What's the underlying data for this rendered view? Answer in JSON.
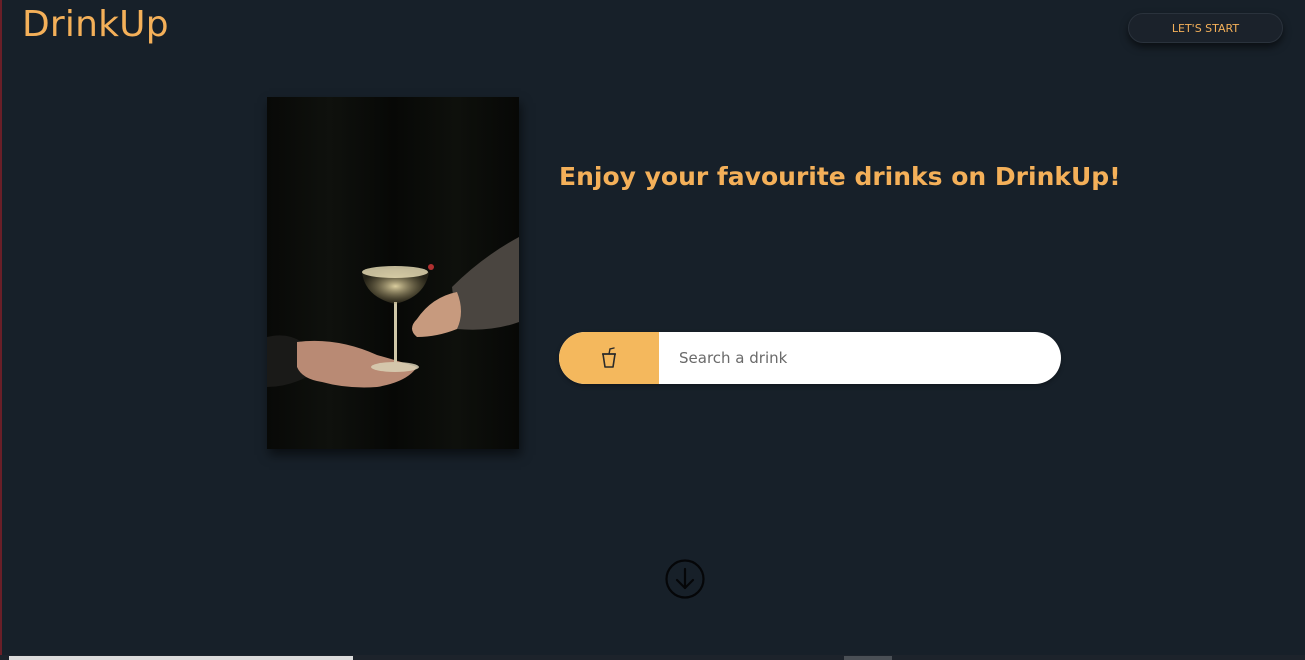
{
  "header": {
    "logo": "DrinkUp",
    "start_button": "LET'S START"
  },
  "hero": {
    "headline": "Enjoy your favourite drinks on DrinkUp!",
    "photo_icon": "cocktail-glass-photo"
  },
  "search": {
    "icon": "cup-with-straw-icon",
    "placeholder": "Search a drink",
    "value": ""
  },
  "scroll": {
    "icon": "arrow-down-circle-icon"
  },
  "colors": {
    "background": "#172029",
    "accent": "#f4b059",
    "search_icon_bg": "#f4b85d"
  }
}
